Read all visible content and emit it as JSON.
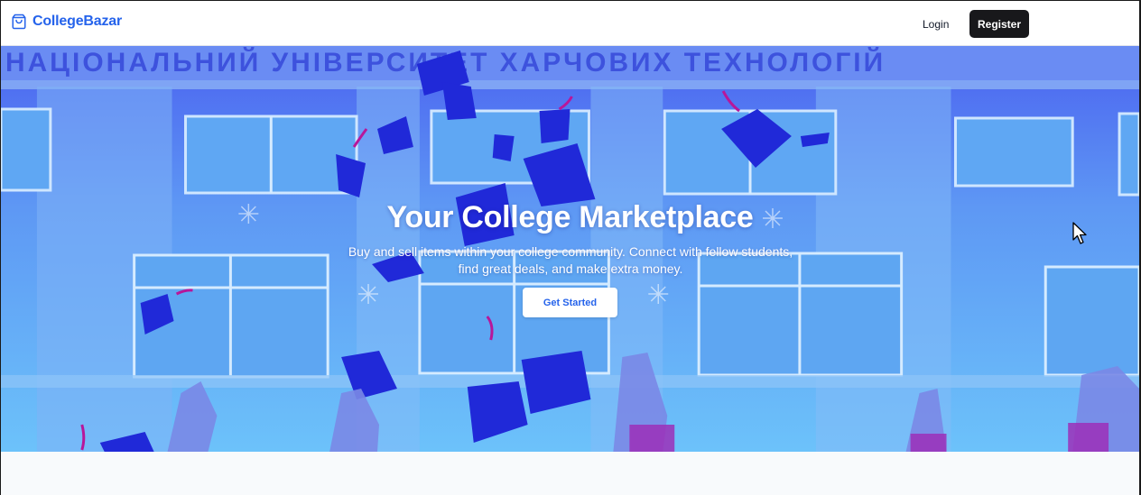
{
  "header": {
    "brand": "CollegeBazar",
    "login_label": "Login",
    "register_label": "Register"
  },
  "hero": {
    "title": "Your College Marketplace",
    "subtitle": "Buy and sell items within your college community. Connect with fellow students, find great deals, and make extra money.",
    "cta_label": "Get Started"
  },
  "icons": {
    "brand": "shopping-bag-icon",
    "cursor": "mouse-pointer-icon"
  },
  "colors": {
    "brand": "#2563eb",
    "register_bg": "#18181b",
    "hero_tint": "#5b8ef5"
  }
}
